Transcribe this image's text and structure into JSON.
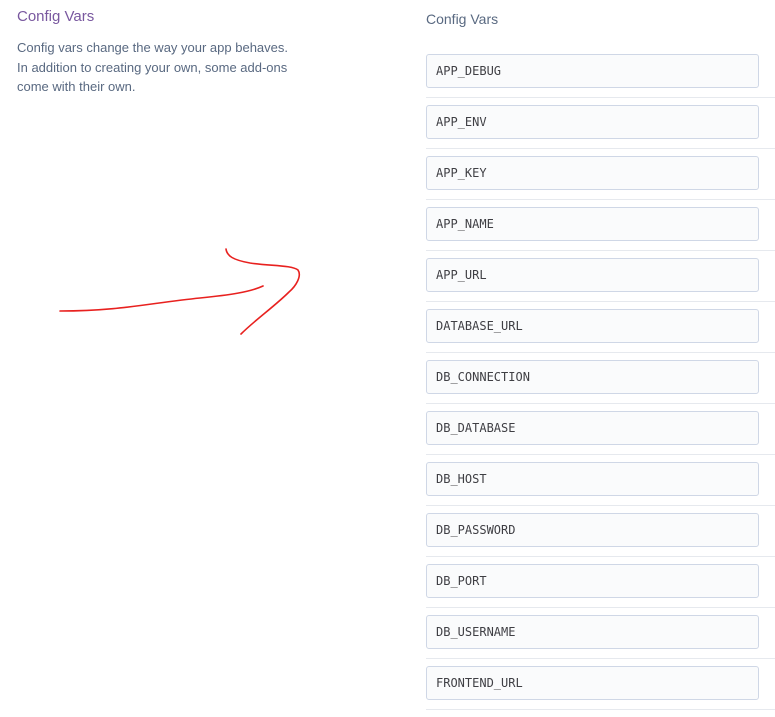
{
  "section": {
    "title": "Config Vars",
    "description": "Config vars change the way your app behaves. In addition to creating your own, some add-ons come with their own."
  },
  "list": {
    "title": "Config Vars",
    "keys": [
      "APP_DEBUG",
      "APP_ENV",
      "APP_KEY",
      "APP_NAME",
      "APP_URL",
      "DATABASE_URL",
      "DB_CONNECTION",
      "DB_DATABASE",
      "DB_HOST",
      "DB_PASSWORD",
      "DB_PORT",
      "DB_USERNAME",
      "FRONTEND_URL"
    ]
  },
  "annotation": {
    "color": "#e8211f",
    "icon": "hand-drawn-arrow-icon"
  }
}
